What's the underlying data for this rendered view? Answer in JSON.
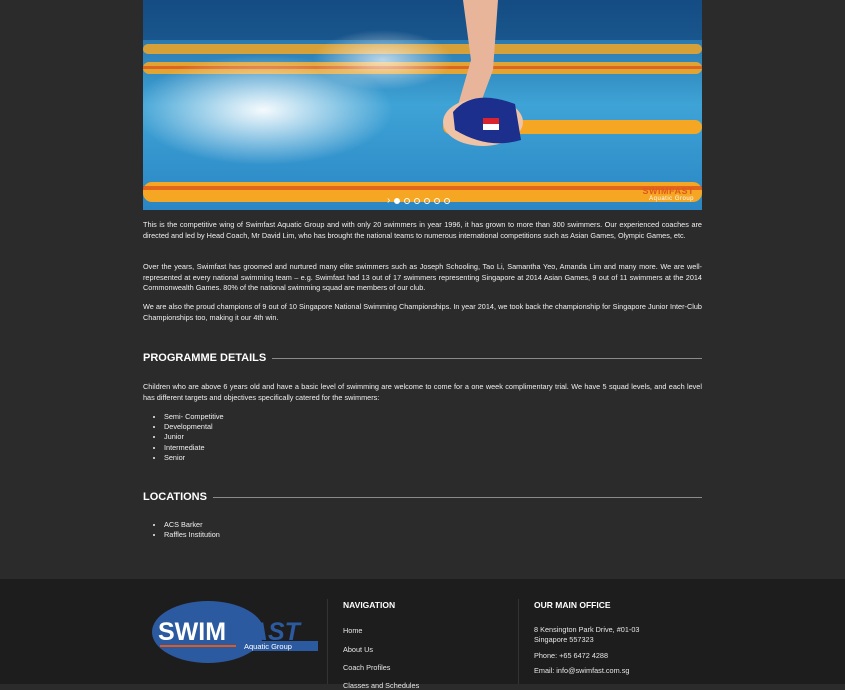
{
  "hero": {
    "logo_text": "SWIMFAST",
    "logo_sub": "Aquatic Group",
    "slide_count": 6,
    "active_slide": 0
  },
  "intro": {
    "p1": "This is the competitive wing of Swimfast Aquatic Group and with only 20 swimmers in year 1996, it has grown to more than 300 swimmers. Our experienced coaches are directed and led by Head Coach, Mr David Lim, who has brought the national teams to numerous international competitions such as Asian Games, Olympic Games, etc.",
    "p2": "Over the years, Swimfast has groomed and nurtured many elite swimmers such as Joseph Schooling, Tao Li, Samantha Yeo, Amanda Lim and many more. We are well-represented at every national swimming team – e.g. Swimfast had 13 out of 17 swimmers representing Singapore at 2014 Asian Games, 9 out of  11 swimmers at the 2014 Commonwealth Games. 80% of the national swimming squad are members of our club.",
    "p3": "We are also the proud champions of 9 out of 10 Singapore National Swimming Championships. In year 2014, we took back the championship for Singapore Junior Inter-Club Championships too, making it our 4th win."
  },
  "programme": {
    "title": "PROGRAMME DETAILS",
    "text": "Children who are above 6 years old and have a basic level of swimming are welcome to come for a one week complimentary trial. We have 5 squad levels, and each level has different targets and objectives specifically catered for the swimmers:",
    "levels": [
      "Semi- Competitive",
      "Developmental",
      "Junior",
      "Intermediate",
      "Senior"
    ]
  },
  "locations": {
    "title": "LOCATIONS",
    "items": [
      "ACS Barker",
      "Raffles Institution"
    ]
  },
  "footer": {
    "logo": {
      "swim": "SWIM",
      "fast": "FAST",
      "sub": "Aquatic Group"
    },
    "nav_title": "NAVIGATION",
    "nav_links": [
      "Home",
      "About Us",
      "Coach Profiles",
      "Classes and Schedules"
    ],
    "office_title": "OUR MAIN OFFICE",
    "address_line1": "8 Kensington Park Drive, #01-03",
    "address_line2": "Singapore 557323",
    "phone": "Phone: +65 6472 4288",
    "email": "Email: info@swimfast.com.sg"
  },
  "colors": {
    "page_bg": "#2b2b2b",
    "footer_bg": "#1d1d1d",
    "logo_blue": "#2c5aa0",
    "logo_orange": "#e05a1e",
    "pool_blue": "#3b8cc4",
    "lane_orange": "#f5a623"
  }
}
